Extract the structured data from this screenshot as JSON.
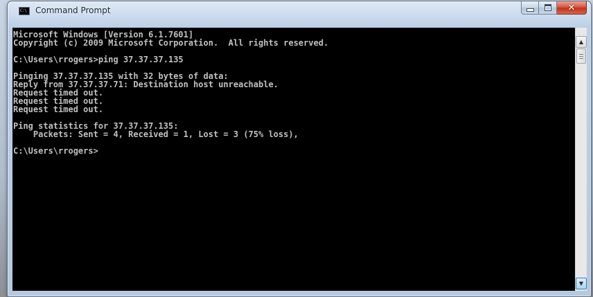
{
  "window": {
    "title": "Command Prompt",
    "icon_label": "C:\\",
    "buttons": {
      "minimize": "minimize",
      "maximize": "maximize",
      "close": "✕"
    }
  },
  "console": {
    "lines": [
      "Microsoft Windows [Version 6.1.7601]",
      "Copyright (c) 2009 Microsoft Corporation.  All rights reserved.",
      "",
      "C:\\Users\\rrogers>ping 37.37.37.135",
      "",
      "Pinging 37.37.37.135 with 32 bytes of data:",
      "Reply from 37.37.37.71: Destination host unreachable.",
      "Request timed out.",
      "Request timed out.",
      "Request timed out.",
      "",
      "Ping statistics for 37.37.37.135:",
      "    Packets: Sent = 4, Received = 1, Lost = 3 (75% loss),",
      "",
      "C:\\Users\\rrogers>"
    ]
  },
  "scrollbar": {
    "up_arrow": "▲",
    "down_arrow": "▼"
  },
  "colors": {
    "console_bg": "#000000",
    "console_fg": "#c0c0c0",
    "close_button": "#c9452b"
  }
}
